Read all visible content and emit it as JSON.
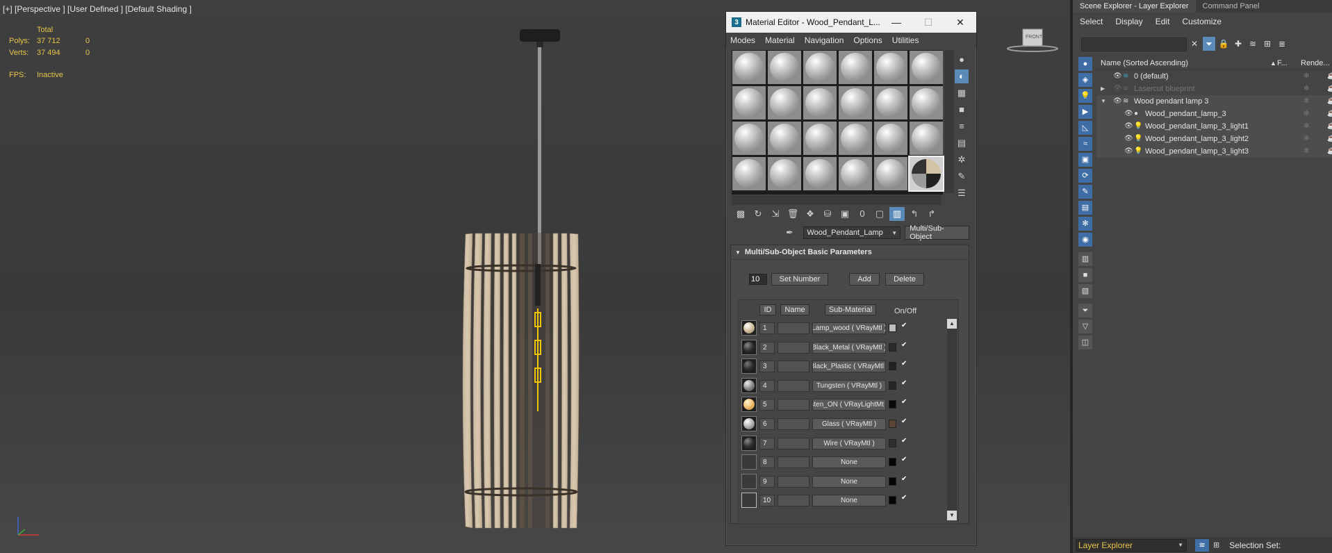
{
  "viewport": {
    "label": "[+] [Perspective ] [User Defined ] [Default Shading ]",
    "stats": {
      "total_label": "Total",
      "polys_label": "Polys:",
      "polys_total": "37 712",
      "polys_sel": "0",
      "verts_label": "Verts:",
      "verts_total": "37 494",
      "verts_sel": "0",
      "fps_label": "FPS:",
      "fps_value": "Inactive"
    },
    "viewcube_label": "FRONT"
  },
  "material_editor": {
    "title": "Material Editor - Wood_Pendant_L...",
    "window_buttons": {
      "minimize": "—",
      "maximize": "☐",
      "close": "✕"
    },
    "menu": [
      "Modes",
      "Material",
      "Navigation",
      "Options",
      "Utilities"
    ],
    "material_name": "Wood_Pendant_Lamp",
    "material_type": "Multi/Sub-Object",
    "rollout_title": "Multi/Sub-Object Basic Parameters",
    "set_number_value": "10",
    "set_number_label": "Set Number",
    "add_label": "Add",
    "delete_label": "Delete",
    "columns": {
      "id": "ID",
      "name": "Name",
      "sub_material": "Sub-Material",
      "on_off": "On/Off"
    },
    "rows": [
      {
        "id": "1",
        "sub": "Lamp_wood  ( VRayMtl )",
        "swatch": "#bdbdbd",
        "ball": "#d6c3a4"
      },
      {
        "id": "2",
        "sub": "Black_Metal  ( VRayMtl )",
        "swatch": "#2a2a2a",
        "ball": "#3a3a3a"
      },
      {
        "id": "3",
        "sub": "Black_Plastic  ( VRayMtl )",
        "swatch": "#222222",
        "ball": "#333333"
      },
      {
        "id": "4",
        "sub": "Tungsten  ( VRayMtl )",
        "swatch": "#262626",
        "ball": "#8a8a8a"
      },
      {
        "id": "5",
        "sub": "ungsten_ON  ( VRayLightMt",
        "swatch": "#0a0a0a",
        "ball": "#f0c070"
      },
      {
        "id": "6",
        "sub": "Glass  ( VRayMtl )",
        "swatch": "#5a4438",
        "ball": "#a8a8a8"
      },
      {
        "id": "7",
        "sub": "Wire  ( VRayMtl )",
        "swatch": "#2e2e2e",
        "ball": "#2e2e2e"
      },
      {
        "id": "8",
        "sub": "None",
        "swatch": "#050505",
        "ball": ""
      },
      {
        "id": "9",
        "sub": "None",
        "swatch": "#050505",
        "ball": ""
      },
      {
        "id": "10",
        "sub": "None",
        "swatch": "#050505",
        "ball": ""
      }
    ]
  },
  "scene_explorer": {
    "tabs": [
      "Scene Explorer - Layer Explorer",
      "Command Panel"
    ],
    "menu": [
      "Select",
      "Display",
      "Edit",
      "Customize"
    ],
    "column_name": "Name (Sorted Ascending)",
    "column_frozen": "F...",
    "column_render": "Rende...",
    "sort_arrow": "▲",
    "rows": [
      {
        "label": "0 (default)",
        "indent": 1,
        "dim": false
      },
      {
        "label": "Lasercut blueprint",
        "indent": 1,
        "dim": true
      },
      {
        "label": "Wood pendant lamp 3",
        "indent": 1,
        "dim": false
      },
      {
        "label": "Wood_pendant_lamp_3",
        "indent": 2,
        "dim": false
      },
      {
        "label": "Wood_pendant_lamp_3_light1",
        "indent": 2,
        "dim": false
      },
      {
        "label": "Wood_pendant_lamp_3_light2",
        "indent": 2,
        "dim": false
      },
      {
        "label": "Wood_pendant_lamp_3_light3",
        "indent": 2,
        "dim": false
      }
    ],
    "bottom_layer": "Layer Explorer",
    "selection_set_label": "Selection Set:"
  }
}
